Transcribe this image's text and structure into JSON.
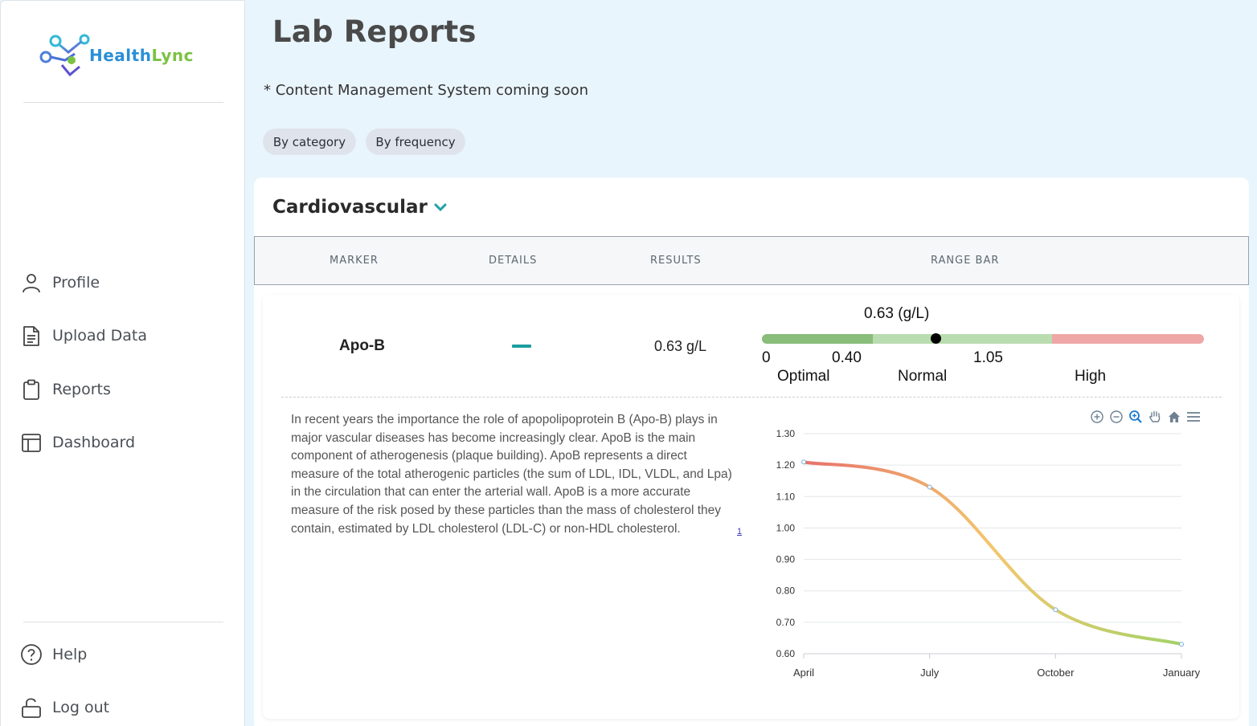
{
  "brand": {
    "name_part1": "Health",
    "name_part2": "Lync"
  },
  "sidebar": {
    "nav": [
      {
        "label": "Profile",
        "icon": "user-icon"
      },
      {
        "label": "Upload Data",
        "icon": "document-icon"
      },
      {
        "label": "Reports",
        "icon": "clipboard-icon"
      },
      {
        "label": "Dashboard",
        "icon": "dashboard-icon"
      }
    ],
    "footer": [
      {
        "label": "Help",
        "icon": "help-icon"
      },
      {
        "label": "Log out",
        "icon": "unlock-icon"
      }
    ]
  },
  "page": {
    "title": "Lab Reports",
    "notice": "* Content Management System coming soon",
    "filters": [
      "By category",
      "By frequency"
    ]
  },
  "section": {
    "title": "Cardiovascular",
    "columns": [
      "MARKER",
      "DETAILS",
      "RESULTS",
      "RANGE BAR"
    ]
  },
  "row": {
    "marker": "Apo-B",
    "result": "0.63 g/L",
    "range": {
      "current_label": "0.63 (g/L)",
      "value": 0.63,
      "min": 0,
      "max": 1.6,
      "ticks": [
        "0",
        "0.40",
        "1.05"
      ],
      "zones": [
        {
          "label": "Optimal",
          "from": 0,
          "to": 0.4,
          "color": "#88bd7a"
        },
        {
          "label": "Normal",
          "from": 0.4,
          "to": 1.05,
          "color": "#b9dcb0"
        },
        {
          "label": "High",
          "from": 1.05,
          "to": 1.6,
          "color": "#eea7a6"
        }
      ]
    },
    "description": "In recent years the importance the role of apopolipoprotein B (Apo-B) plays in major vascular diseases has become increasingly clear. ApoB is the main component of atherogenesis (plaque building). ApoB represents a direct measure of the total atherogenic particles (the sum of LDL, IDL, VLDL, and Lpa) in the circulation that can enter the arterial wall. ApoB is a more accurate measure of the risk posed by these particles than the mass of cholesterol they contain, estimated by LDL cholesterol (LDL-C) or non-HDL cholesterol.",
    "footnote": "1"
  },
  "chart_data": {
    "type": "line",
    "categories": [
      "April",
      "July",
      "October",
      "January"
    ],
    "series": [
      {
        "values": [
          1.21,
          1.13,
          0.74,
          0.63
        ]
      }
    ],
    "ylim": [
      0.6,
      1.3
    ],
    "yticks": [
      "1.30",
      "1.20",
      "1.10",
      "1.00",
      "0.90",
      "0.80",
      "0.70",
      "0.60"
    ],
    "grid": true,
    "gradient": [
      "#e8706b",
      "#f2c76e",
      "#a3d268"
    ],
    "toolbar_icons": [
      "zoom-in-icon",
      "zoom-out-icon",
      "zoom-select-icon",
      "pan-hand-icon",
      "home-icon",
      "menu-icon"
    ]
  }
}
